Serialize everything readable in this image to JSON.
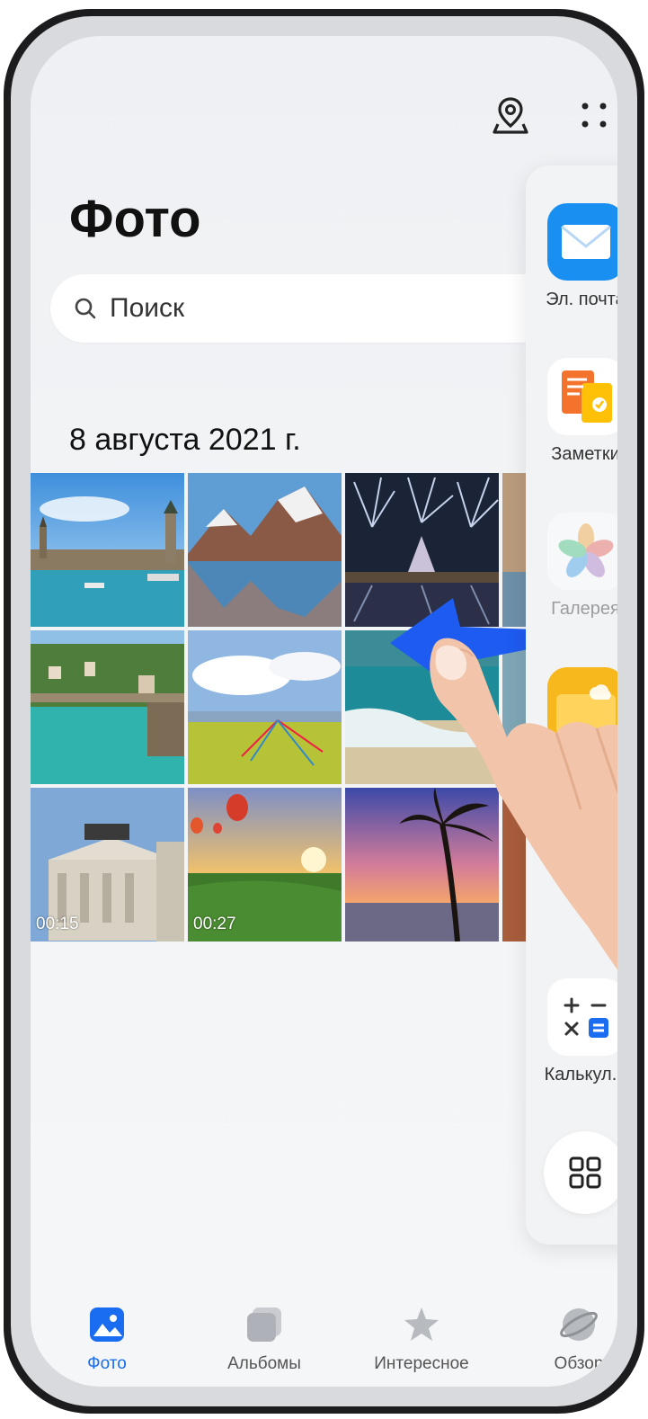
{
  "header": {
    "title": "Фото"
  },
  "search": {
    "placeholder": "Поиск"
  },
  "section": {
    "date": "8 августа 2021 г."
  },
  "photos": [
    {
      "name": "river-city"
    },
    {
      "name": "mountain-lake"
    },
    {
      "name": "fireworks-castle"
    },
    {
      "name": "town-river"
    },
    {
      "name": "meadow-flags"
    },
    {
      "name": "beach-waves"
    },
    {
      "name": "classical-building",
      "duration": "00:15"
    },
    {
      "name": "balloons-sunset",
      "duration": "00:27"
    },
    {
      "name": "palm-sunset"
    }
  ],
  "dock": {
    "items": [
      {
        "label": "Эл. почта",
        "icon": "mail-icon"
      },
      {
        "label": "Заметки",
        "icon": "notes-icon"
      },
      {
        "label": "Галерея",
        "icon": "gallery-icon"
      },
      {
        "label": "",
        "icon": "files-icon"
      },
      {
        "label": "Калькул. .",
        "icon": "calculator-icon"
      }
    ],
    "more_icon": "grid-icon"
  },
  "tabs": [
    {
      "label": "Фото",
      "icon": "photo-icon",
      "active": true
    },
    {
      "label": "Альбомы",
      "icon": "albums-icon"
    },
    {
      "label": "Интересное",
      "icon": "star-icon"
    },
    {
      "label": "Обзор",
      "icon": "discover-icon"
    }
  ],
  "colors": {
    "accent": "#1a6cf0",
    "arrow": "#1e5bf0"
  }
}
